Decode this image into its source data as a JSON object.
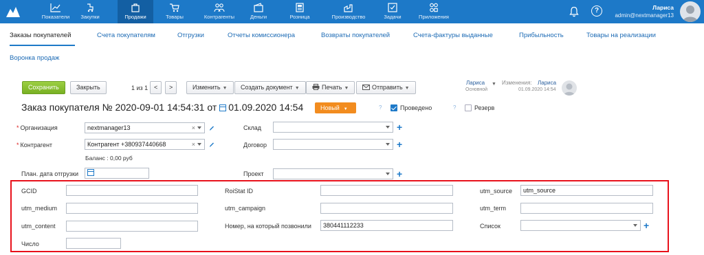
{
  "nav": {
    "items": [
      {
        "label": "Показатели",
        "icon": "chart-icon"
      },
      {
        "label": "Закупки",
        "icon": "purchases-icon"
      },
      {
        "label": "Продажи",
        "icon": "bag-icon"
      },
      {
        "label": "Товары",
        "icon": "cart-icon"
      },
      {
        "label": "Контрагенты",
        "icon": "people-icon"
      },
      {
        "label": "Деньги",
        "icon": "wallet-icon"
      },
      {
        "label": "Розница",
        "icon": "register-icon"
      },
      {
        "label": "Производство",
        "icon": "factory-icon"
      },
      {
        "label": "Задачи",
        "icon": "tasks-icon"
      },
      {
        "label": "Приложения",
        "icon": "apps-icon"
      }
    ],
    "active": "Продажи",
    "user_name": "Лариса",
    "user_email": "admin@nextmanager13",
    "help": "?",
    "accent": "#1d79c8"
  },
  "subtabs": [
    "Заказы покупателей",
    "Счета покупателям",
    "Отгрузки",
    "Отчеты комиссионера",
    "Возвраты покупателей",
    "Счета-фактуры выданные",
    "Прибыльность",
    "Товары на реализации",
    "Воронка продаж"
  ],
  "toolbar": {
    "save": "Сохранить",
    "close": "Закрыть",
    "pager": "1 из 1",
    "prev": "<",
    "next": ">",
    "edit": "Изменить",
    "create_doc": "Создать документ",
    "print": "Печать",
    "send": "Отправить",
    "owner_name": "Лариса",
    "owner_group": "Основной",
    "changes_label": "Изменения:",
    "changes_user": "Лариса",
    "changes_date": "01.09.2020 14:54"
  },
  "doc": {
    "title": "Заказ покупателя №  2020-09-01 14:54:31  от",
    "date": "01.09.2020 14:54",
    "status": "Новый",
    "status_color": "#f28c1f",
    "posted_label": "Проведено",
    "reserve_label": "Резерв",
    "q1": "?",
    "q2": "?"
  },
  "form": {
    "org_label": "Организация",
    "org_value": "nextmanager13",
    "cp_label": "Контрагент",
    "cp_value": "Контрагент +380937440668",
    "balance": "Баланс : 0,00 руб",
    "ship_label": "План. дата отгрузки",
    "warehouse_label": "Склад",
    "contract_label": "Договор",
    "project_label": "Проект",
    "required_mark": "*",
    "clear_mark": "×",
    "plus": "+"
  },
  "custom": {
    "gcid": "GCID",
    "utm_medium": "utm_medium",
    "utm_content": "utm_content",
    "number_label": "Число",
    "roistat": "RoiStat ID",
    "utm_campaign": "utm_campaign",
    "called_label": "Номер, на который позвонили",
    "called_value": "380441112233",
    "utm_source": "utm_source",
    "utm_source_value": "utm_source",
    "utm_term": "utm_term",
    "list_label": "Список"
  }
}
